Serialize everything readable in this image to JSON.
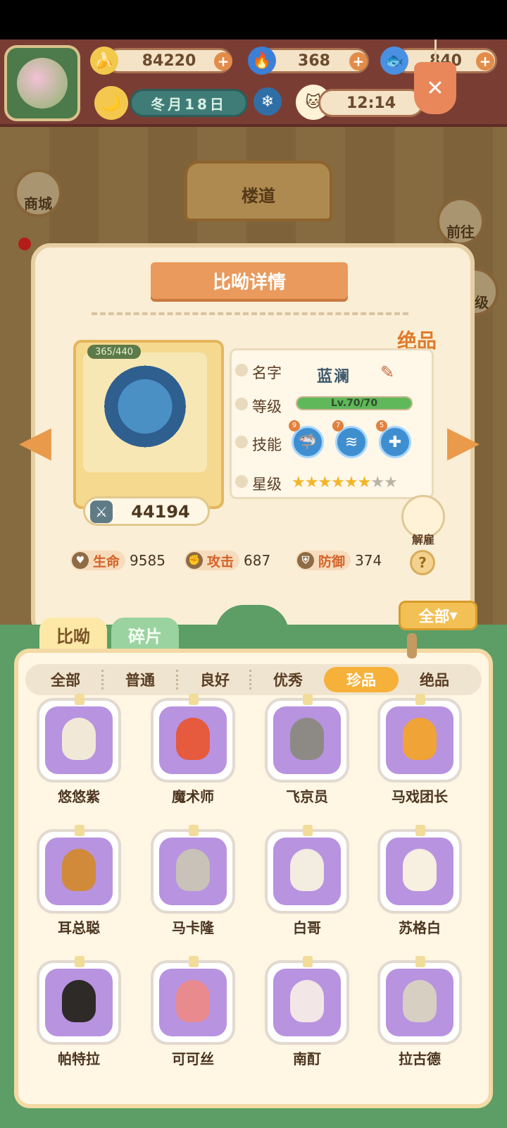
{
  "resources": {
    "banana": "84220",
    "flame": "368",
    "fish": "840"
  },
  "calendar": {
    "date": "冬月18日",
    "time": "12:14"
  },
  "room": {
    "name": "楼道"
  },
  "side_buttons": {
    "shop": "商城",
    "goto": "前往",
    "level": "等级"
  },
  "detail": {
    "title": "比呦详情",
    "quality": "绝品",
    "hp_badge": "365/440",
    "power": "44194",
    "labels": {
      "name": "名字",
      "level": "等级",
      "skill": "技能",
      "star": "星级"
    },
    "name": "蓝澜",
    "level_text": "Lv.70/70",
    "level_progress": 1.0,
    "skill_levels": [
      "9",
      "7",
      "5"
    ],
    "stars": {
      "filled": 6,
      "total": 8
    },
    "dismiss": "解雇",
    "stats": [
      {
        "label": "生命",
        "value": "9585",
        "icon": "heart-icon"
      },
      {
        "label": "攻击",
        "value": "687",
        "icon": "paw-attack-icon"
      },
      {
        "label": "防御",
        "value": "374",
        "icon": "shield-icon"
      }
    ],
    "help": "?"
  },
  "filter": {
    "label": "全部"
  },
  "tabs": [
    {
      "label": "比呦",
      "active": true
    },
    {
      "label": "碎片",
      "active": false
    }
  ],
  "rarity_filters": [
    {
      "label": "全部"
    },
    {
      "label": "普通"
    },
    {
      "label": "良好"
    },
    {
      "label": "优秀"
    },
    {
      "label": "珍品",
      "active": true
    },
    {
      "label": "绝品"
    }
  ],
  "characters": [
    {
      "name": "悠悠紫",
      "face": "#f1e8d8"
    },
    {
      "name": "魔术师",
      "face": "#e65a3e"
    },
    {
      "name": "飞京员",
      "face": "#8d8a86"
    },
    {
      "name": "马戏团长",
      "face": "#f0a336"
    },
    {
      "name": "耳总聪",
      "face": "#d08a3a"
    },
    {
      "name": "马卡隆",
      "face": "#c9c2b8"
    },
    {
      "name": "白哥",
      "face": "#f2ece1"
    },
    {
      "name": "苏格白",
      "face": "#f7efdf"
    },
    {
      "name": "帕特拉",
      "face": "#2e2a28"
    },
    {
      "name": "可可丝",
      "face": "#e98a8f"
    },
    {
      "name": "南酊",
      "face": "#f3e6e6"
    },
    {
      "name": "拉古德",
      "face": "#d6cfc2"
    }
  ],
  "colors": {
    "accent": "#f6b13a",
    "panel_green": "#5c9e66",
    "tile_purple": "#b893e0"
  }
}
